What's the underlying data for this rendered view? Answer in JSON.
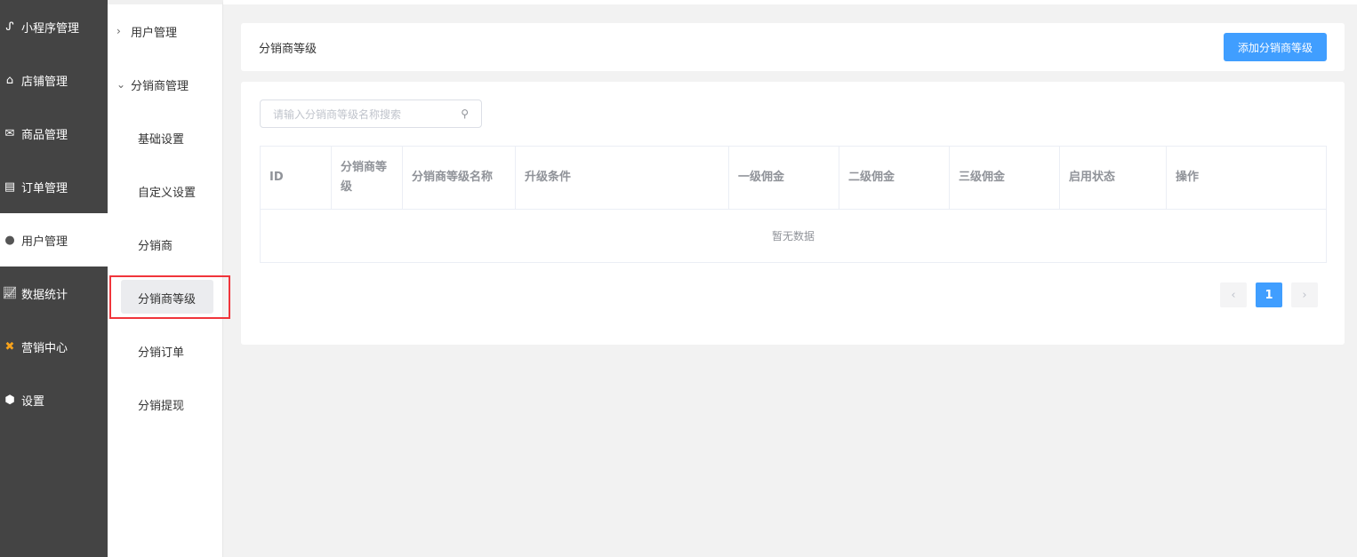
{
  "sidebar": {
    "items": [
      {
        "label": "小程序管理",
        "icon": "link-icon"
      },
      {
        "label": "店铺管理",
        "icon": "shop-icon"
      },
      {
        "label": "商品管理",
        "icon": "mail-icon"
      },
      {
        "label": "订单管理",
        "icon": "clipboard-icon"
      },
      {
        "label": "用户管理",
        "icon": "user-icon",
        "active": true
      },
      {
        "label": "数据统计",
        "icon": "chart-icon"
      },
      {
        "label": "营销中心",
        "icon": "marketing-icon"
      },
      {
        "label": "设置",
        "icon": "gear-icon"
      }
    ]
  },
  "submenu": {
    "groups": [
      {
        "label": "用户管理"
      },
      {
        "label": "分销商管理"
      }
    ],
    "items": [
      {
        "label": "基础设置"
      },
      {
        "label": "自定义设置"
      },
      {
        "label": "分销商"
      },
      {
        "label": "分销商等级",
        "selected": true
      },
      {
        "label": "分销订单"
      },
      {
        "label": "分销提现"
      }
    ]
  },
  "header": {
    "title": "分销商等级",
    "add_button": "添加分销商等级"
  },
  "search": {
    "placeholder": "请输入分销商等级名称搜索"
  },
  "table": {
    "columns": [
      "ID",
      "分销商等级",
      "分销商等级名称",
      "升级条件",
      "一级佣金",
      "二级佣金",
      "三级佣金",
      "启用状态",
      "操作"
    ],
    "empty_text": "暂无数据"
  },
  "pagination": {
    "current": "1",
    "prev": "‹",
    "next": "›"
  },
  "colors": {
    "accent": "#409eff",
    "sidebar": "#444444",
    "highlight": "#f0353b"
  }
}
